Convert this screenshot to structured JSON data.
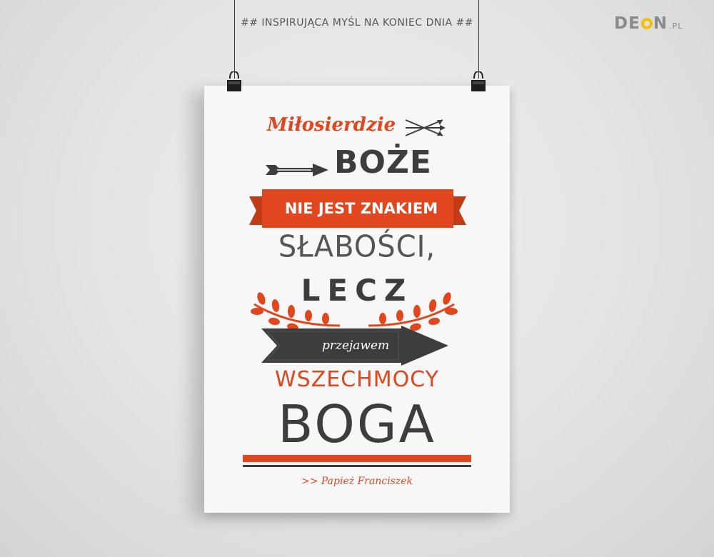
{
  "header": {
    "title": "## INSPIRUJĄCA MYŚL NA KONIEC DNIA ##",
    "logo_part1": "DE",
    "logo_part2": "N",
    "logo_suffix": ".PL"
  },
  "poster": {
    "line1": "Miłosierdzie",
    "line2": "BOŻE",
    "line3": "NIE JEST ZNAKIEM",
    "line4": "SŁABOŚCI,",
    "line5": "LECZ",
    "line6": "przejawem",
    "line7": "WSZECHMOCY",
    "line8": "BOGA",
    "author": ">>  Papież Franciszek"
  },
  "colors": {
    "accent": "#e2461e",
    "dark": "#3d3d3d",
    "logo_ring": "#f2c200"
  }
}
